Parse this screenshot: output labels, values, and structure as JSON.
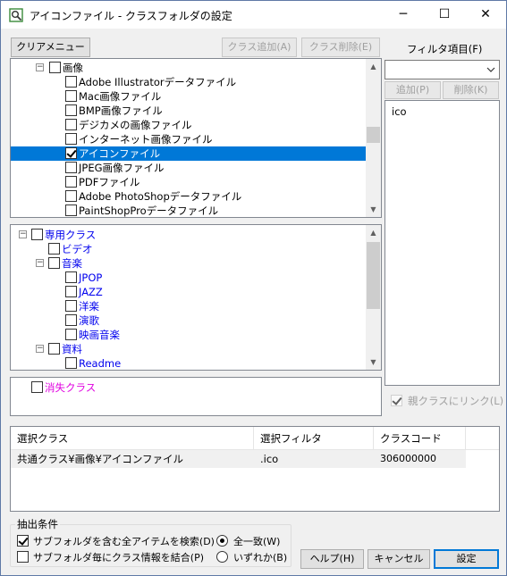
{
  "window": {
    "title": "アイコンファイル - クラスフォルダの設定",
    "minimize": "─",
    "maximize": "☐",
    "close": "✕"
  },
  "toolbar": {
    "clear_menu": "クリアメニュー",
    "add_class": "クラス追加(A)",
    "delete_class": "クラス削除(E)"
  },
  "tree1": {
    "nodes": [
      {
        "label": "画像",
        "expander": "−",
        "checked": false
      },
      {
        "label": "Adobe Illustratorデータファイル",
        "checked": false
      },
      {
        "label": "Mac画像ファイル",
        "checked": false
      },
      {
        "label": "BMP画像ファイル",
        "checked": false
      },
      {
        "label": "デジカメの画像ファイル",
        "checked": false
      },
      {
        "label": "インターネット画像ファイル",
        "checked": false
      },
      {
        "label": "アイコンファイル",
        "checked": true,
        "selected": true
      },
      {
        "label": "JPEG画像ファイル",
        "checked": false
      },
      {
        "label": "PDFファイル",
        "checked": false
      },
      {
        "label": "Adobe PhotoShopデータファイル",
        "checked": false
      },
      {
        "label": "PaintShopProデータファイル",
        "checked": false
      }
    ]
  },
  "tree2": {
    "nodes": [
      {
        "label": "専用クラス",
        "expander": "−"
      },
      {
        "label": "ビデオ"
      },
      {
        "label": "音楽",
        "expander": "−"
      },
      {
        "label": "JPOP"
      },
      {
        "label": "JAZZ"
      },
      {
        "label": "洋楽"
      },
      {
        "label": "演歌"
      },
      {
        "label": "映画音楽"
      },
      {
        "label": "資料",
        "expander": "−"
      },
      {
        "label": "Readme"
      }
    ]
  },
  "lost_class": {
    "label": "消失クラス"
  },
  "filter": {
    "title": "フィルタ項目(F)",
    "combo_value": "",
    "add": "追加(P)",
    "delete": "削除(K)",
    "items": [
      "ico"
    ],
    "link_parent": "親クラスにリンク(L)"
  },
  "table": {
    "headers": [
      "選択クラス",
      "選択フィルタ",
      "クラスコード"
    ],
    "rows": [
      [
        "共通クラス¥画像¥アイコンファイル",
        ".ico",
        "306000000"
      ]
    ]
  },
  "extract": {
    "title": "抽出条件",
    "opt1": "サブフォルダを含む全アイテムを検索(D)",
    "opt2": "サブフォルダ毎にクラス情報を結合(P)",
    "radio1": "全一致(W)",
    "radio2": "いずれか(B)"
  },
  "buttons": {
    "help": "ヘルプ(H)",
    "cancel": "キャンセル",
    "ok": "設定"
  }
}
